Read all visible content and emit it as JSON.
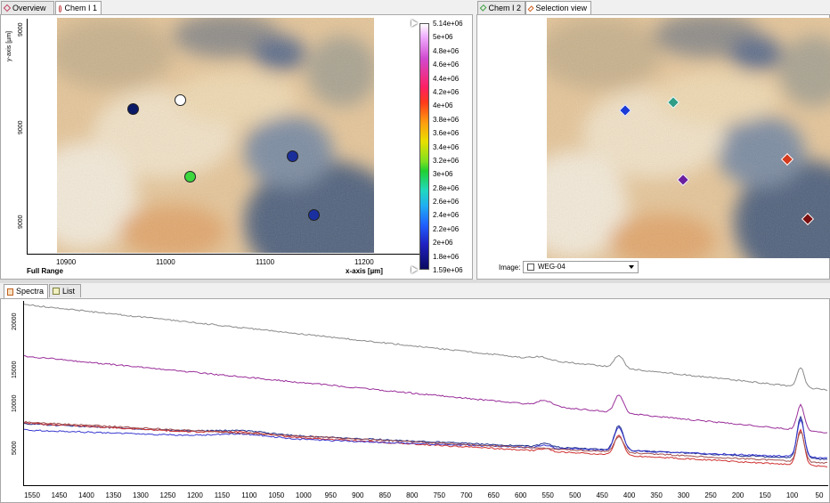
{
  "tabs_top_left": [
    {
      "label": "Overview",
      "icon": "overview-icon",
      "active": false
    },
    {
      "label": "Chem I 1",
      "icon": "chem-map-icon",
      "active": true
    }
  ],
  "tabs_top_right": [
    {
      "label": "Chem I 2",
      "icon": "chem-map-icon",
      "active": false
    },
    {
      "label": "Selection view",
      "icon": "selection-icon",
      "active": true
    }
  ],
  "tabs_bottom": [
    {
      "label": "Spectra",
      "icon": "spectra-icon",
      "active": true
    },
    {
      "label": "List",
      "icon": "list-icon",
      "active": false
    }
  ],
  "map": {
    "y_axis_label": "y-axis [µm]",
    "y_ticks": [
      "9000",
      "9000",
      "9000"
    ],
    "x_ticks": [
      "10900",
      "11000",
      "11100",
      "11200"
    ],
    "x_axis_label": "x-axis [µm]",
    "full_range_label": "Full Range"
  },
  "colorbar": {
    "labels": [
      "5.14e+06",
      "5e+06",
      "4.8e+06",
      "4.6e+06",
      "4.4e+06",
      "4.2e+06",
      "4e+06",
      "3.8e+06",
      "3.6e+06",
      "3.4e+06",
      "3.2e+06",
      "3e+06",
      "2.8e+06",
      "2.6e+06",
      "2.4e+06",
      "2.2e+06",
      "2e+06",
      "1.8e+06",
      "1.59e+06"
    ]
  },
  "markers_left": [
    {
      "color": "#0b1a66"
    },
    {
      "color": "#ffffff"
    },
    {
      "color": "#1b2f9a"
    },
    {
      "color": "#3ed63e"
    },
    {
      "color": "#1a2fa0"
    }
  ],
  "markers_right": [
    {
      "color": "#1c3bd6"
    },
    {
      "color": "#2f9e86"
    },
    {
      "color": "#d43a1c"
    },
    {
      "color": "#6a1fa0"
    },
    {
      "color": "#7a0f0f"
    }
  ],
  "image_selector": {
    "label": "Image:",
    "value": "WEG-04"
  },
  "spectra": {
    "y_ticks": [
      "20000",
      "15000",
      "10000",
      "5000"
    ],
    "x_ticks": [
      "1550",
      "1450",
      "1400",
      "1350",
      "1300",
      "1250",
      "1200",
      "1150",
      "1100",
      "1050",
      "1000",
      "950",
      "900",
      "850",
      "800",
      "750",
      "700",
      "650",
      "600",
      "550",
      "500",
      "450",
      "400",
      "350",
      "300",
      "250",
      "200",
      "150",
      "100",
      "50"
    ],
    "series_colors": [
      "#8a8a8a",
      "#9a2f9a",
      "#1f2f8a",
      "#d03030",
      "#3a3ad0",
      "#a05050"
    ]
  }
}
